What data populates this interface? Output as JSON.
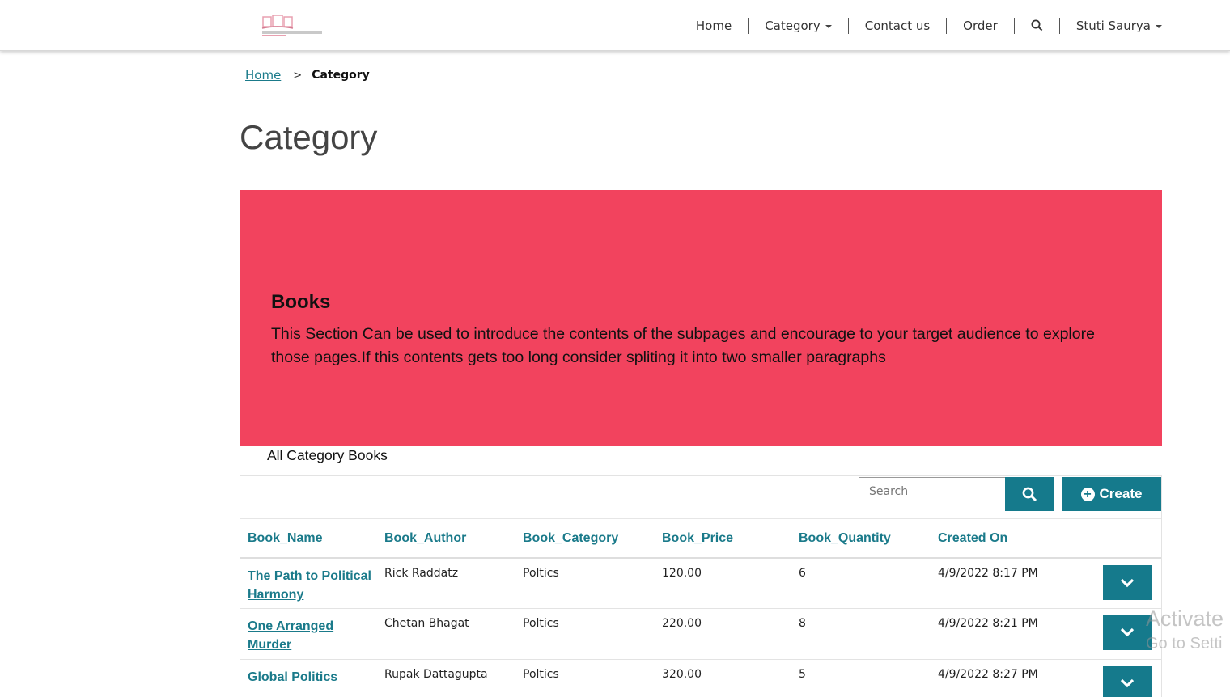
{
  "nav": {
    "items": [
      {
        "label": "Home",
        "dropdown": false
      },
      {
        "label": "Category",
        "dropdown": true
      },
      {
        "label": "Contact us",
        "dropdown": false
      },
      {
        "label": "Order",
        "dropdown": false
      },
      {
        "label": "",
        "icon": "search-icon",
        "dropdown": false
      },
      {
        "label": "Stuti Saurya",
        "dropdown": true
      }
    ]
  },
  "logo": {
    "icon": "bookstore-logo"
  },
  "breadcrumb": {
    "home": "Home",
    "separator": ">",
    "current": "Category"
  },
  "page_title": "Category",
  "banner": {
    "title": "Books",
    "text": "This Section Can be used to introduce the contents of the subpages and encourage to your target audience to explore those pages.If this contents gets too long consider spliting it into two smaller paragraphs",
    "color": "#f2435e"
  },
  "section_label": "All Category Books",
  "toolbar": {
    "search_placeholder": "Search",
    "create_label": "Create"
  },
  "table": {
    "headers": [
      "Book_Name",
      "Book_Author",
      "Book_Category",
      "Book_Price",
      "Book_Quantity",
      "Created On"
    ],
    "rows": [
      {
        "name": "The Path to Political Harmony",
        "author": "Rick Raddatz",
        "category": "Poltics",
        "price": "120.00",
        "quantity": "6",
        "created": "4/9/2022 8:17 PM"
      },
      {
        "name": "One Arranged Murder",
        "author": "Chetan Bhagat",
        "category": "Poltics",
        "price": "220.00",
        "quantity": "8",
        "created": "4/9/2022 8:21 PM"
      },
      {
        "name": "Global Politics",
        "author": "Rupak Dattagupta",
        "category": "Poltics",
        "price": "320.00",
        "quantity": "5",
        "created": "4/9/2022 8:27 PM"
      }
    ]
  },
  "colors": {
    "accent": "#157a8c",
    "link": "#1a7a8a"
  },
  "watermark": {
    "line1": "Activate",
    "line2": "Go to Setti"
  }
}
